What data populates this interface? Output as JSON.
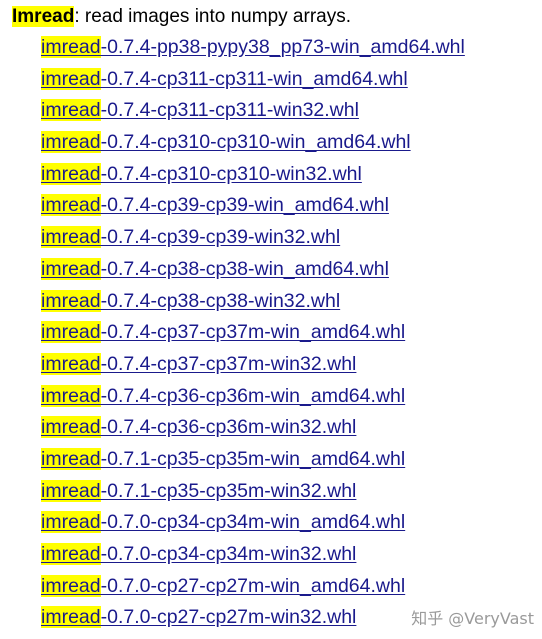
{
  "header": {
    "package_name": "Imread",
    "description": ": read images into numpy arrays."
  },
  "files": [
    {
      "prefix": "imread",
      "rest": "-0.7.4-pp38-pypy38_pp73-win_amd64.whl"
    },
    {
      "prefix": "imread",
      "rest": "-0.7.4-cp311-cp311-win_amd64.whl"
    },
    {
      "prefix": "imread",
      "rest": "-0.7.4-cp311-cp311-win32.whl"
    },
    {
      "prefix": "imread",
      "rest": "-0.7.4-cp310-cp310-win_amd64.whl"
    },
    {
      "prefix": "imread",
      "rest": "-0.7.4-cp310-cp310-win32.whl"
    },
    {
      "prefix": "imread",
      "rest": "-0.7.4-cp39-cp39-win_amd64.whl"
    },
    {
      "prefix": "imread",
      "rest": "-0.7.4-cp39-cp39-win32.whl"
    },
    {
      "prefix": "imread",
      "rest": "-0.7.4-cp38-cp38-win_amd64.whl"
    },
    {
      "prefix": "imread",
      "rest": "-0.7.4-cp38-cp38-win32.whl"
    },
    {
      "prefix": "imread",
      "rest": "-0.7.4-cp37-cp37m-win_amd64.whl"
    },
    {
      "prefix": "imread",
      "rest": "-0.7.4-cp37-cp37m-win32.whl"
    },
    {
      "prefix": "imread",
      "rest": "-0.7.4-cp36-cp36m-win_amd64.whl"
    },
    {
      "prefix": "imread",
      "rest": "-0.7.4-cp36-cp36m-win32.whl"
    },
    {
      "prefix": "imread",
      "rest": "-0.7.1-cp35-cp35m-win_amd64.whl"
    },
    {
      "prefix": "imread",
      "rest": "-0.7.1-cp35-cp35m-win32.whl"
    },
    {
      "prefix": "imread",
      "rest": "-0.7.0-cp34-cp34m-win_amd64.whl"
    },
    {
      "prefix": "imread",
      "rest": "-0.7.0-cp34-cp34m-win32.whl"
    },
    {
      "prefix": "imread",
      "rest": "-0.7.0-cp27-cp27m-win_amd64.whl"
    },
    {
      "prefix": "imread",
      "rest": "-0.7.0-cp27-cp27m-win32.whl"
    }
  ],
  "watermark": "知乎 @VeryVast",
  "colors": {
    "highlight": "#ffff00",
    "link": "#1a1a8c",
    "watermark": "#9a9a9a"
  }
}
